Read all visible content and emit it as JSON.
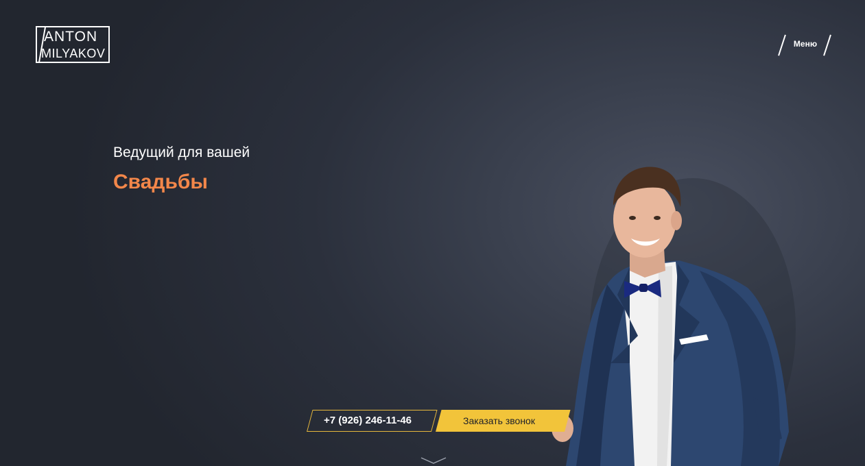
{
  "logo": {
    "line1": "ANTON",
    "line2": "MILYAKOV"
  },
  "menu": {
    "label": "Меню"
  },
  "hero": {
    "subtitle": "Ведущий для вашей",
    "title": "Свадьбы",
    "accent_color": "#f3874a"
  },
  "cta": {
    "phone": "+7 (926) 246-11-46",
    "call_label": "Заказать звонок",
    "call_color": "#f2c43a"
  },
  "icons": {
    "scroll": "chevron-down-icon"
  }
}
